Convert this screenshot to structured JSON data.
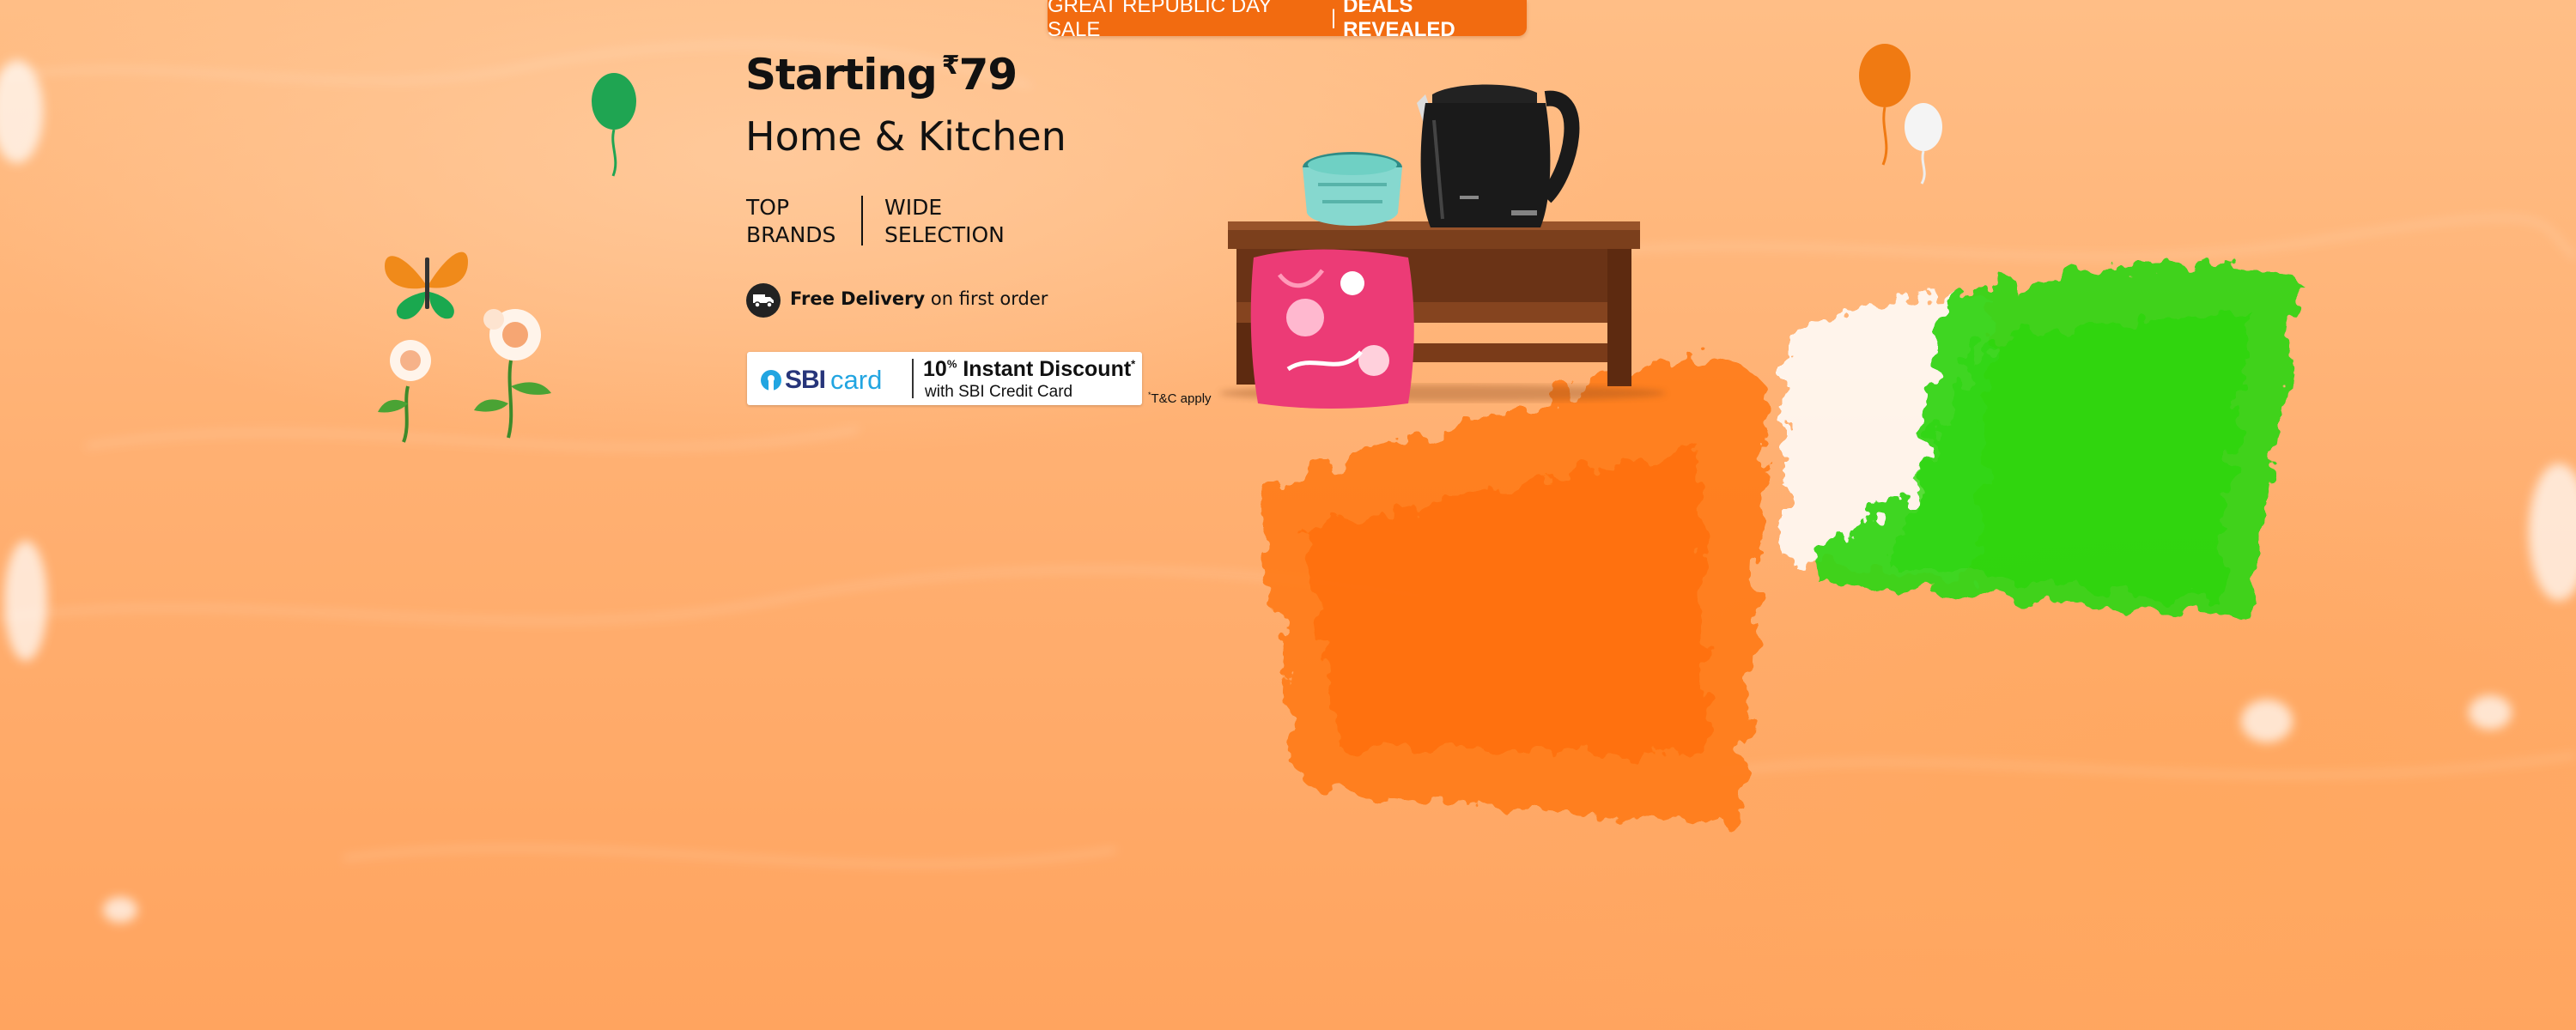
{
  "sale_tag": {
    "prefix": "GREAT REPUBLIC DAY SALE",
    "separator": "|",
    "highlight": "DEALS REVEALED"
  },
  "headline": {
    "text": "Starting",
    "currency": "₹",
    "price": "79"
  },
  "category": "Home & Kitchen",
  "features": [
    {
      "line1": "TOP",
      "line2": "BRANDS"
    },
    {
      "line1": "WIDE",
      "line2": "SELECTION"
    }
  ],
  "delivery": {
    "icon": "delivery-truck-icon",
    "bold": "Free Delivery",
    "rest": "on first order"
  },
  "offer": {
    "brand": "SBI",
    "brand_suffix": "card",
    "discount_value": "10",
    "discount_unit": "%",
    "discount_label": "Instant Discount",
    "discount_mark": "*",
    "sub": "with SBI Credit Card",
    "tnc_mark": "*",
    "tnc": "T&C apply"
  },
  "colors": {
    "saffron": "#f26b10",
    "green": "#39d61b",
    "background": "#ffb072",
    "sbi_blue": "#22a5e1",
    "sbi_navy": "#27357a"
  },
  "decor_icons": [
    "balloon-icon",
    "butterfly-icon",
    "flower-icon",
    "tricolor-flag-paint"
  ],
  "products": [
    "kettle",
    "chopper",
    "cushion",
    "coffee-table"
  ]
}
